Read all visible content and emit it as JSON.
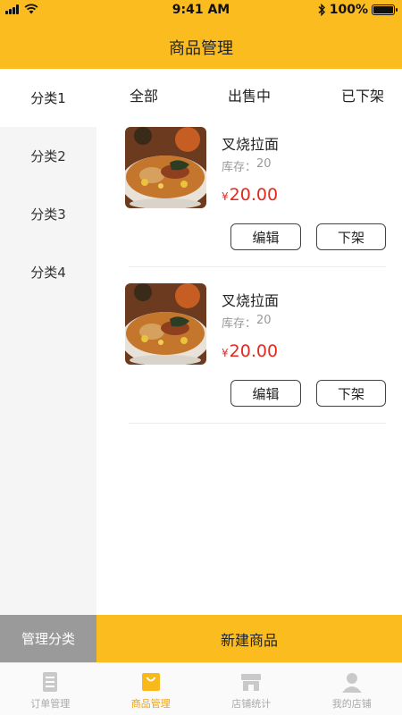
{
  "status_bar": {
    "time": "9:41 AM",
    "battery": "100%"
  },
  "header": {
    "title": "商品管理"
  },
  "sidebar": {
    "categories": [
      {
        "label": "分类1",
        "active": true
      },
      {
        "label": "分类2",
        "active": false
      },
      {
        "label": "分类3",
        "active": false
      },
      {
        "label": "分类4",
        "active": false
      }
    ]
  },
  "tabs": [
    {
      "label": "全部",
      "active": true
    },
    {
      "label": "出售中",
      "active": false
    },
    {
      "label": "已下架",
      "active": false
    }
  ],
  "products": [
    {
      "name": "叉烧拉面",
      "stock_label": "库存：",
      "stock_value": "20",
      "currency": "¥",
      "price": "20.00",
      "edit_label": "编辑",
      "off_label": "下架"
    },
    {
      "name": "叉烧拉面",
      "stock_label": "库存：",
      "stock_value": "20",
      "currency": "¥",
      "price": "20.00",
      "edit_label": "编辑",
      "off_label": "下架"
    }
  ],
  "actions": {
    "manage_categories": "管理分类",
    "new_product": "新建商品"
  },
  "tabbar": [
    {
      "label": "订单管理",
      "icon": "order-icon",
      "active": false
    },
    {
      "label": "商品管理",
      "icon": "bag-icon",
      "active": true
    },
    {
      "label": "店铺统计",
      "icon": "store-icon",
      "active": false
    },
    {
      "label": "我的店铺",
      "icon": "person-icon",
      "active": false
    }
  ],
  "colors": {
    "accent": "#FBBC1F",
    "price": "#E4291E",
    "tab_active": "#F2A20A",
    "sidebar_bg": "#f5f5f5"
  }
}
